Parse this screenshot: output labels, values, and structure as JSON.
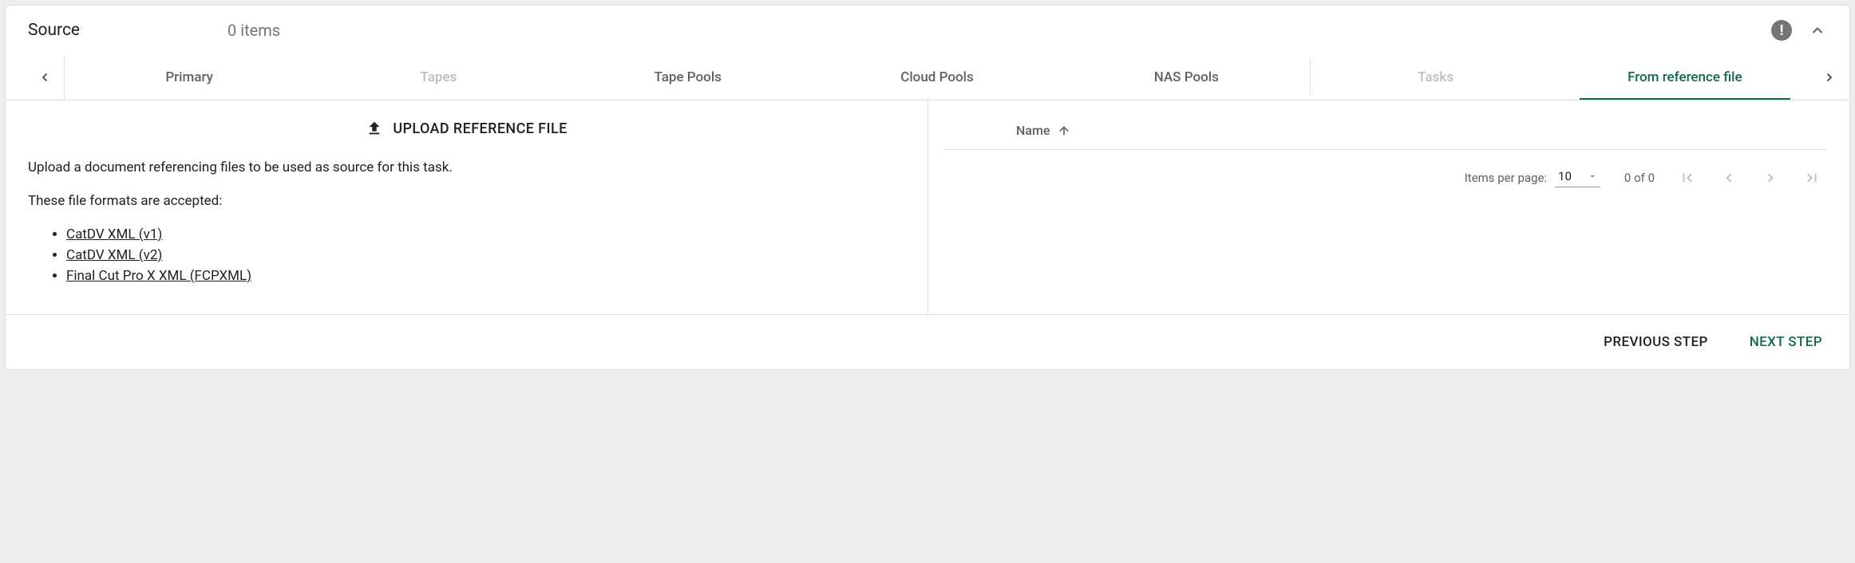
{
  "header": {
    "title": "Source",
    "items_text": "0 items"
  },
  "tabs": {
    "list": [
      {
        "label": "Primary"
      },
      {
        "label": "Tapes"
      },
      {
        "label": "Tape Pools"
      },
      {
        "label": "Cloud Pools"
      },
      {
        "label": "NAS Pools"
      },
      {
        "label": "Tasks"
      },
      {
        "label": "From reference file"
      }
    ]
  },
  "left": {
    "upload_label": "UPLOAD REFERENCE FILE",
    "description": "Upload a document referencing files to be used as source for this task.",
    "accepted_intro": "These file formats are accepted:",
    "formats": [
      {
        "label": "CatDV XML (v1)"
      },
      {
        "label": "CatDV XML (v2)"
      },
      {
        "label": "Final Cut Pro X XML (FCPXML)"
      }
    ]
  },
  "right": {
    "name_col": "Name",
    "ipp_label": "Items per page:",
    "ipp_value": "10",
    "range_text": "0 of 0"
  },
  "footer": {
    "prev": "PREVIOUS STEP",
    "next": "NEXT STEP"
  }
}
